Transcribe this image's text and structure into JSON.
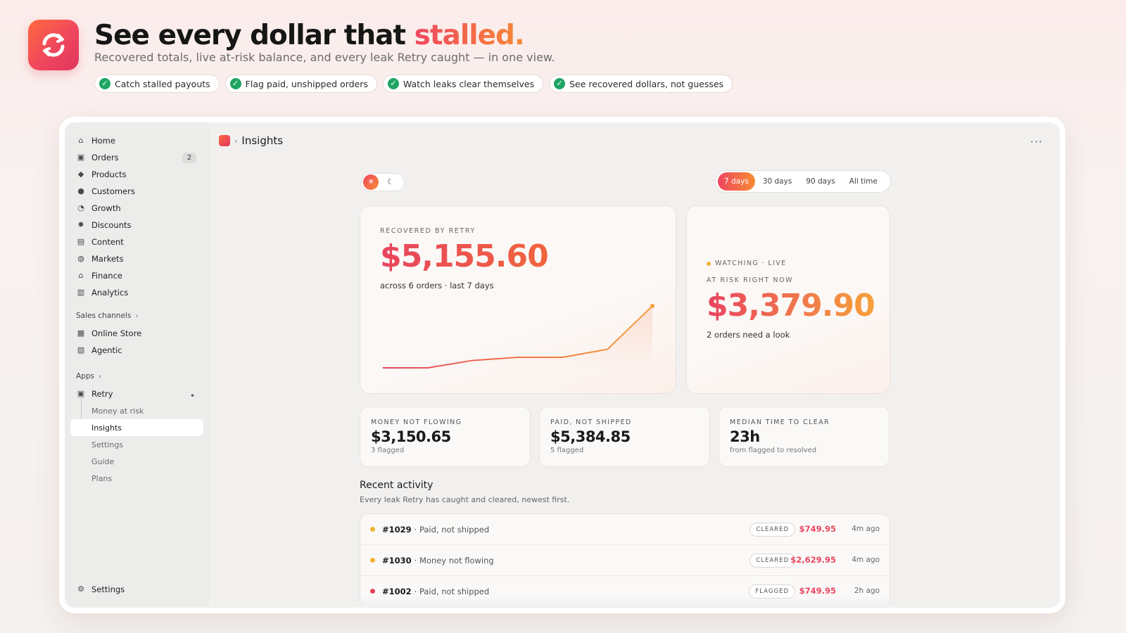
{
  "hero": {
    "title_main": "See every dollar that ",
    "title_accent": "stalled.",
    "subtitle": "Recovered totals, live at-risk balance, and every leak Retry caught — in one view.",
    "chips": [
      "Catch stalled payouts",
      "Flag paid, unshipped orders",
      "Watch leaks clear themselves",
      "See recovered dollars, not guesses"
    ]
  },
  "sidebar": {
    "items": [
      {
        "label": "Home",
        "icon": "home-icon"
      },
      {
        "label": "Orders",
        "icon": "inbox-icon",
        "badge": "2"
      },
      {
        "label": "Products",
        "icon": "tag-icon"
      },
      {
        "label": "Customers",
        "icon": "person-icon"
      },
      {
        "label": "Growth",
        "icon": "gauge-icon"
      },
      {
        "label": "Discounts",
        "icon": "discount-icon"
      },
      {
        "label": "Content",
        "icon": "content-icon"
      },
      {
        "label": "Markets",
        "icon": "globe-icon"
      },
      {
        "label": "Finance",
        "icon": "bank-icon"
      },
      {
        "label": "Analytics",
        "icon": "bar-chart-icon"
      }
    ],
    "sales_channels": {
      "label": "Sales channels",
      "items": [
        {
          "label": "Online Store",
          "icon": "store-icon"
        },
        {
          "label": "Agentic",
          "icon": "agent-icon"
        }
      ]
    },
    "apps": {
      "label": "Apps",
      "retry": "Retry",
      "sub_items": [
        "Money at risk",
        "Insights",
        "Settings",
        "Guide",
        "Plans"
      ]
    },
    "settings": "Settings"
  },
  "topbar": {
    "page_title": "Insights",
    "more": "···"
  },
  "periods": [
    "7 days",
    "30 days",
    "90 days",
    "All time"
  ],
  "active_period": "7 days",
  "recovered": {
    "eyebrow": "RECOVERED BY RETRY",
    "amount": "$5,155.60",
    "caption": "across 6 orders · last 7 days"
  },
  "chart_data": {
    "type": "line",
    "title": "",
    "xlabel": "",
    "ylabel": "",
    "x": [
      1,
      2,
      3,
      4,
      5,
      6,
      7
    ],
    "series": [
      {
        "values": [
          0,
          0,
          12,
          17,
          17,
          30,
          100
        ]
      }
    ],
    "ylim": [
      0,
      100
    ],
    "grid": false,
    "colors": [
      "#e8465e",
      "#f4a03a"
    ]
  },
  "at_risk": {
    "live": "WATCHING · LIVE",
    "eyebrow": "AT RISK RIGHT NOW",
    "amount": "$3,379.90",
    "caption": "2 orders need a look"
  },
  "stats": [
    {
      "label": "MONEY NOT FLOWING",
      "value": "$3,150.65",
      "note": "3 flagged"
    },
    {
      "label": "PAID, NOT SHIPPED",
      "value": "$5,384.85",
      "note": "5 flagged"
    },
    {
      "label": "MEDIAN TIME TO CLEAR",
      "value": "23h",
      "note": "from flagged to resolved"
    }
  ],
  "activity": {
    "title": "Recent activity",
    "subtitle": "Every leak Retry has caught and cleared, newest first.",
    "rows": [
      {
        "order": "#1029",
        "reason": "· Paid, not shipped",
        "status": "CLEARED",
        "amount": "$749.95",
        "age": "4m ago",
        "dot": "#f2b233"
      },
      {
        "order": "#1030",
        "reason": "· Money not flowing",
        "status": "CLEARED",
        "amount": "$2,629.95",
        "age": "4m ago",
        "dot": "#f2b233"
      },
      {
        "order": "#1002",
        "reason": "· Paid, not shipped",
        "status": "FLAGGED",
        "amount": "$749.95",
        "age": "2h ago",
        "dot": "#e6435b"
      }
    ]
  },
  "colors": {
    "accent_start": "#ef4660",
    "accent_end": "#f78b34",
    "check": "#1fa463"
  }
}
